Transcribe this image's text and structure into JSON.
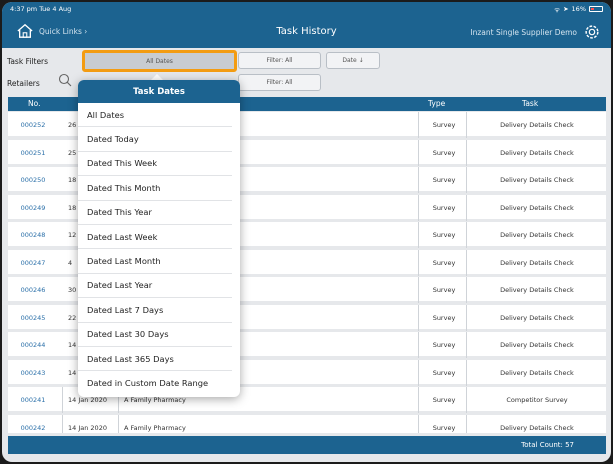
{
  "status": {
    "time": "4:37 pm",
    "date": "Tue 4 Aug",
    "battery": "16%"
  },
  "nav": {
    "quick_links": "Quick Links ›",
    "title": "Task History",
    "company": "Inzant Single Supplier Demo"
  },
  "filters": {
    "task_filters_label": "Task Filters",
    "retailers_label": "Retailers",
    "dates_pill": "All Dates",
    "filter_all_1": "Filter: All",
    "date_sort": "Date ↓",
    "filter_all_2": "Filter: All"
  },
  "table": {
    "headers": {
      "no": "No.",
      "type": "Type",
      "task": "Task"
    },
    "rows": [
      {
        "no": "000252",
        "date": "26",
        "retailer": "",
        "type": "Survey",
        "task": "Delivery Details Check"
      },
      {
        "no": "000251",
        "date": "25",
        "retailer": "",
        "type": "Survey",
        "task": "Delivery Details Check"
      },
      {
        "no": "000250",
        "date": "18",
        "retailer": "",
        "type": "Survey",
        "task": "Delivery Details Check"
      },
      {
        "no": "000249",
        "date": "18",
        "retailer": "",
        "type": "Survey",
        "task": "Delivery Details Check"
      },
      {
        "no": "000248",
        "date": "12",
        "retailer": "",
        "type": "Survey",
        "task": "Delivery Details Check"
      },
      {
        "no": "000247",
        "date": "4",
        "retailer": "",
        "type": "Survey",
        "task": "Delivery Details Check"
      },
      {
        "no": "000246",
        "date": "30",
        "retailer": "",
        "type": "Survey",
        "task": "Delivery Details Check"
      },
      {
        "no": "000245",
        "date": "22",
        "retailer": "",
        "type": "Survey",
        "task": "Delivery Details Check"
      },
      {
        "no": "000244",
        "date": "14",
        "retailer": "",
        "type": "Survey",
        "task": "Delivery Details Check"
      },
      {
        "no": "000243",
        "date": "14",
        "retailer": "",
        "type": "Survey",
        "task": "Delivery Details Check"
      },
      {
        "no": "000241",
        "date": "14 Jan 2020",
        "retailer": "A Family Pharmacy",
        "type": "Survey",
        "task": "Competitor Survey"
      },
      {
        "no": "000242",
        "date": "14 Jan 2020",
        "retailer": "A Family Pharmacy",
        "type": "Survey",
        "task": "Delivery Details Check"
      }
    ]
  },
  "footer": {
    "total_count": "Total Count: 57"
  },
  "popover": {
    "title": "Task Dates",
    "options": [
      "All Dates",
      "Dated Today",
      "Dated This Week",
      "Dated This Month",
      "Dated This Year",
      "Dated Last Week",
      "Dated Last Month",
      "Dated Last Year",
      "Dated Last 7 Days",
      "Dated Last 30 Days",
      "Dated Last 365 Days",
      "Dated in Custom Date Range"
    ]
  },
  "colors": {
    "brand": "#1c6390",
    "highlight": "#f39c12",
    "link": "#2a6fa8"
  }
}
